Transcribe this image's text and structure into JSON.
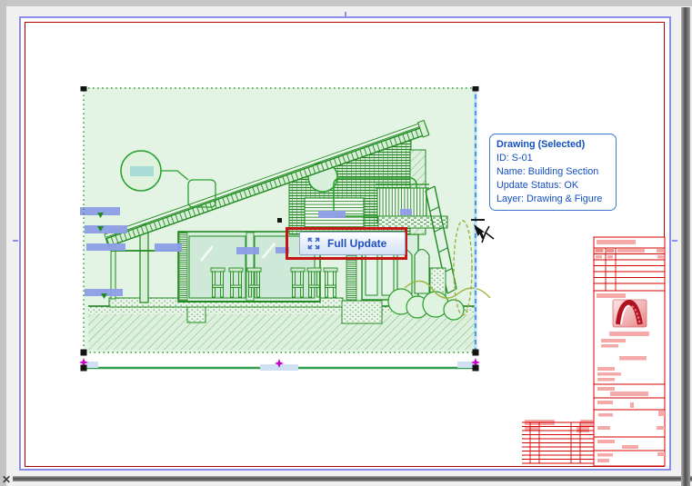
{
  "window": {
    "origin_marker": "✕"
  },
  "tooltip": {
    "title": "Drawing (Selected)",
    "lines": [
      "ID: S-01",
      "Name: Building Section",
      "Update Status: OK",
      "Layer: Drawing & Figure"
    ]
  },
  "update_button": {
    "label": "Full Update"
  },
  "selected_drawing": {
    "id": "S-01",
    "name": "Building Section",
    "update_status": "OK",
    "layer": "Drawing & Figure"
  },
  "colors": {
    "selection_green": "#2aa02a",
    "drawing_green": "#1f8a1f",
    "drawing_tint": "#e3f4e5",
    "highlight_red": "#c41414",
    "titleblock_red": "#d40000",
    "titleblock_pink": "#f5a9a9",
    "paper_border_blue": "#8d8dec",
    "margin_red": "#ad0000",
    "dimension_blue": "#8e9ee8",
    "edge_highlight_blue": "#4a9ae0",
    "tooltip_blue": "#1550c0",
    "hotspot_magenta": "#cc00cc",
    "pasteboard_gray": "#f0f0f0"
  }
}
